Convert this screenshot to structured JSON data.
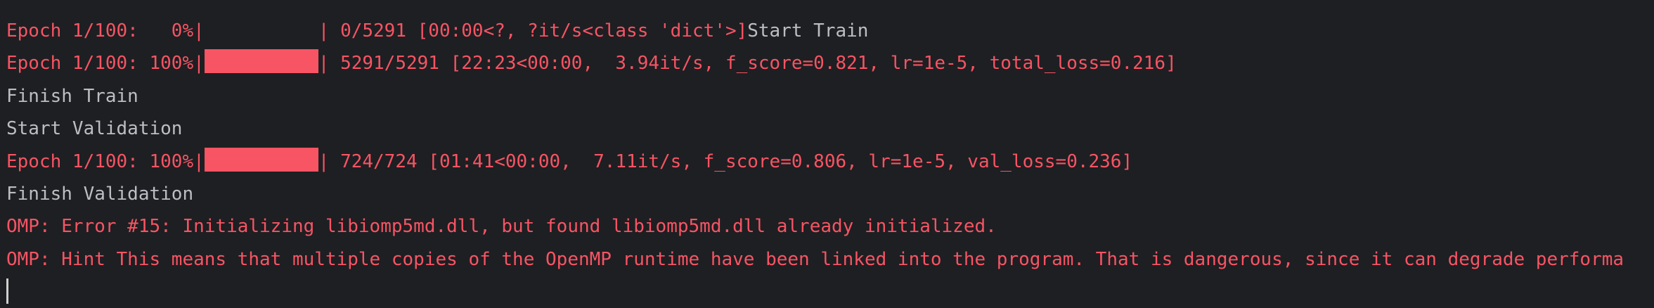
{
  "console": {
    "line1": {
      "prefix": "Epoch 1/100:   0%|",
      "progress": 0,
      "suffix_err": "| 0/5291 [00:00<?, ?it/s<class 'dict'>]",
      "suffix_out": "Start Train"
    },
    "line2": {
      "prefix": "Epoch 1/100: 100%|",
      "progress": 1,
      "suffix": "| 5291/5291 [22:23<00:00,  3.94it/s, f_score=0.821, lr=1e-5, total_loss=0.216]"
    },
    "line3": "Finish Train",
    "line4": "Start Validation",
    "line5": {
      "prefix": "Epoch 1/100: 100%|",
      "progress": 1,
      "suffix": "| 724/724 [01:41<00:00,  7.11it/s, f_score=0.806, lr=1e-5, val_loss=0.236]"
    },
    "line6": "Finish Validation",
    "line7": "OMP: Error #15: Initializing libiomp5md.dll, but found libiomp5md.dll already initialized.",
    "line8": "OMP: Hint This means that multiple copies of the OpenMP runtime have been linked into the program. That is dangerous, since it can degrade performa"
  },
  "colors": {
    "background": "#1e1f22",
    "stderr": "#f75464",
    "stdout": "#bcbec4"
  }
}
